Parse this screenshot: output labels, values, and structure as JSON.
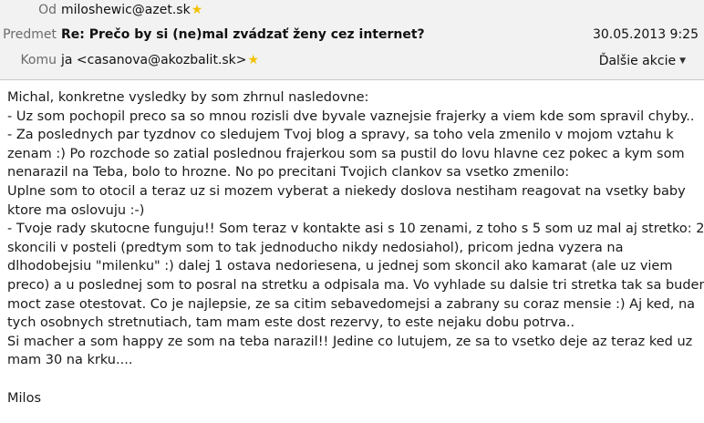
{
  "header": {
    "from_label": "Od",
    "from_value": "miloshewic@azet.sk",
    "subject_label": "Predmet",
    "subject_value": "Re: Prečo by si (ne)mal zvádzať ženy cez internet?",
    "date": "30.05.2013 9:25",
    "to_label": "Komu",
    "to_value": "ja <casanova@akozbalit.sk>",
    "more_actions": "Ďalšie akcie",
    "star_icon": "star-icon",
    "star_color": "#f2c200"
  },
  "message": {
    "lines": [
      "Michal, konkretne vysledky by som zhrnul nasledovne:",
      "- Uz som pochopil preco sa so mnou rozisli dve byvale vaznejsie frajerky a viem kde som spravil chyby..",
      "- Za poslednych par tyzdnov co sledujem Tvoj blog a spravy, sa toho vela zmenilo v mojom vztahu k",
      "zenam :) Po rozchode so zatial poslednou frajerkou som sa pustil do lovu hlavne cez pokec a kym som",
      "nenarazil na Teba, bolo to hrozne. No po precitani Tvojich clankov sa vsetko zmenilo:",
      "Uplne som to otocil a teraz uz si mozem vyberat a niekedy doslova nestiham reagovat na vsetky baby",
      "ktore ma oslovuju :-)",
      "- Tvoje rady skutocne funguju!! Som teraz v kontakte asi s 10 zenami, z toho s 5 som uz mal aj stretko: 2",
      "skoncili v posteli (predtym som to tak jednoducho nikdy nedosiahol), pricom jedna vyzera na",
      "dlhodobejsiu \"milenku\" :) dalej 1 ostava nedoriesena, u jednej som skoncil ako kamarat (ale uz viem",
      "preco) a u poslednej som to posral na stretku a odpisala ma. Vo vyhlade su dalsie tri stretka tak sa budem",
      "moct zase otestovat. Co je najlepsie, ze sa citim sebavedomejsi a zabrany su coraz mensie :) Aj ked, na",
      "tych osobnych stretnutiach, tam mam este dost rezervy, to este nejaku dobu potrva..",
      "Si macher a som happy ze som na teba narazil!! Jedine co lutujem, ze sa to vsetko deje az teraz ked uz",
      "mam 30 na krku...."
    ],
    "signature": "Milos"
  }
}
